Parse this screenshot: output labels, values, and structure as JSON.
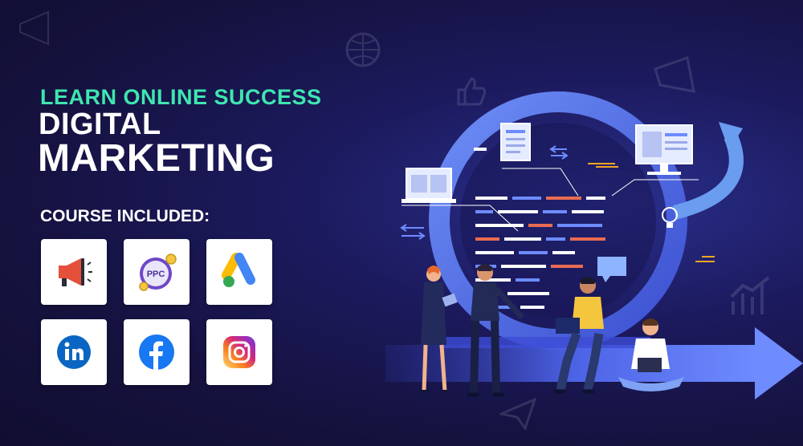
{
  "header": {
    "tagline": "LEARN ONLINE SUCCESS",
    "title_line1": "DIGITAL",
    "title_line2": "MARKETING"
  },
  "course": {
    "heading": "COURSE INCLUDED:",
    "ppc_label": "PPC",
    "icons": [
      "megaphone-icon",
      "ppc-icon",
      "google-ads-icon",
      "linkedin-icon",
      "facebook-icon",
      "instagram-icon"
    ]
  },
  "colors": {
    "accent": "#3ee6b0",
    "background": "#15123f",
    "ring": "#5b7cf0",
    "google_blue": "#4285f4",
    "google_yellow": "#fbbc04",
    "google_green": "#34a853",
    "linkedin": "#0a66c2",
    "facebook": "#1877f2",
    "megaphone_red": "#e4503a"
  }
}
